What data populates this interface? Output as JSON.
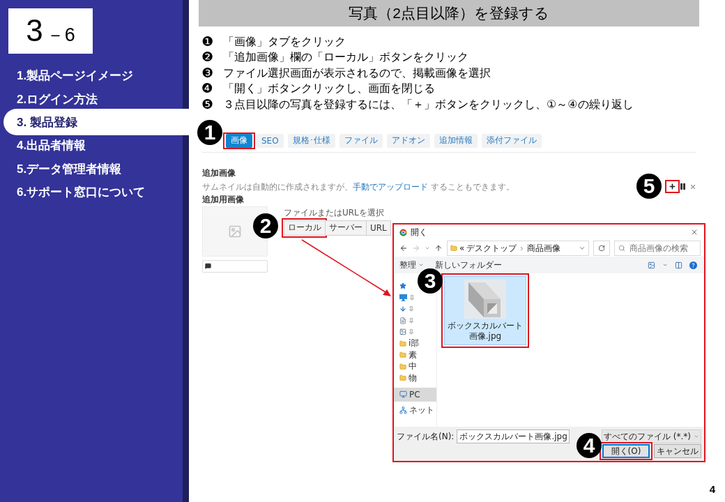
{
  "badge": {
    "major": "3",
    "minor": "－6"
  },
  "sidebar": {
    "items": [
      {
        "label": "1.製品ページイメージ",
        "selected": false
      },
      {
        "label": "2.ログイン方法",
        "selected": false
      },
      {
        "label": "3. 製品登録",
        "selected": true
      },
      {
        "label": "4.出品者情報",
        "selected": false
      },
      {
        "label": "5.データ管理者情報",
        "selected": false
      },
      {
        "label": "6.サポート窓口について",
        "selected": false
      }
    ]
  },
  "header": {
    "title": "写真（2点目以降）を登録する"
  },
  "steps": [
    {
      "bullet": "❶",
      "text": "「画像」タブをクリック"
    },
    {
      "bullet": "❷",
      "text": "「追加画像」欄の「ローカル」ボタンをクリック"
    },
    {
      "bullet": "❸",
      "text": "ファイル選択画面が表示されるので、掲載画像を選択"
    },
    {
      "bullet": "❹",
      "text": "「開く」ボタンクリックし、画面を閉じる"
    },
    {
      "bullet": "❺",
      "text": "３点目以降の写真を登録するには、「＋」ボタンをクリックし、①～④の繰り返し"
    }
  ],
  "form": {
    "tabs": [
      {
        "label": "画像",
        "selected": true,
        "callout": "1"
      },
      {
        "label": "SEO",
        "selected": false
      },
      {
        "label": "規格･仕様",
        "selected": false
      },
      {
        "label": "ファイル",
        "selected": false
      },
      {
        "label": "アドオン",
        "selected": false
      },
      {
        "label": "追加情報",
        "selected": false
      },
      {
        "label": "添付ファイル",
        "selected": false
      }
    ],
    "section_title": "追加画像",
    "description": {
      "before": "サムネイルは自動的に作成されますが、",
      "link": "手動でアップロード",
      "after": " することもできます。"
    },
    "actions": [
      {
        "kind": "add",
        "callout": "5"
      },
      {
        "kind": "handle"
      },
      {
        "kind": "remove"
      }
    ],
    "field_label": "追加用画像",
    "source_label": "ファイルまたはURLを選択",
    "source_buttons": [
      {
        "label": "ローカル",
        "callout": "2"
      },
      {
        "label": "サーバー"
      },
      {
        "label": "URL"
      }
    ]
  },
  "dialog": {
    "title": "開く",
    "address": {
      "overflow": "«",
      "path": [
        "デスクトップ",
        "商品画像"
      ]
    },
    "search": {
      "placeholder": "商品画像の検索"
    },
    "toolbar": {
      "organize": "整理",
      "new_folder": "新しいフォルダー"
    },
    "nav_pane": [
      {
        "kind": "star",
        "pinned": false,
        "selected": false
      },
      {
        "kind": "desktop",
        "pinned": true,
        "selected": false
      },
      {
        "kind": "download",
        "pinned": true,
        "selected": false
      },
      {
        "kind": "document",
        "pinned": true,
        "selected": false
      },
      {
        "kind": "picture",
        "pinned": true,
        "selected": false
      },
      {
        "kind": "folder",
        "label": "i部",
        "pinned": false,
        "selected": false
      },
      {
        "kind": "folder",
        "label": "素",
        "pinned": false,
        "selected": false
      },
      {
        "kind": "folder",
        "label": "中",
        "pinned": false,
        "selected": false
      },
      {
        "kind": "folder",
        "label": "物",
        "pinned": false,
        "selected": false
      },
      {
        "kind": "pc",
        "label": "PC",
        "pinned": false,
        "selected": true
      },
      {
        "kind": "network",
        "label": "ネット",
        "pinned": false,
        "selected": false
      }
    ],
    "files": [
      {
        "name": "ボックスカルバート画像.jpg",
        "selected": true,
        "callout": "3"
      }
    ],
    "file_name": {
      "label": "ファイル名(N):",
      "value": "ボックスカルバート画像.jpg"
    },
    "file_type": "すべてのファイル (*.*)",
    "buttons": [
      {
        "label": "開く(O)",
        "default": true,
        "callout": "4"
      },
      {
        "label": "キャンセル",
        "default": false
      }
    ]
  },
  "page_number": "4"
}
